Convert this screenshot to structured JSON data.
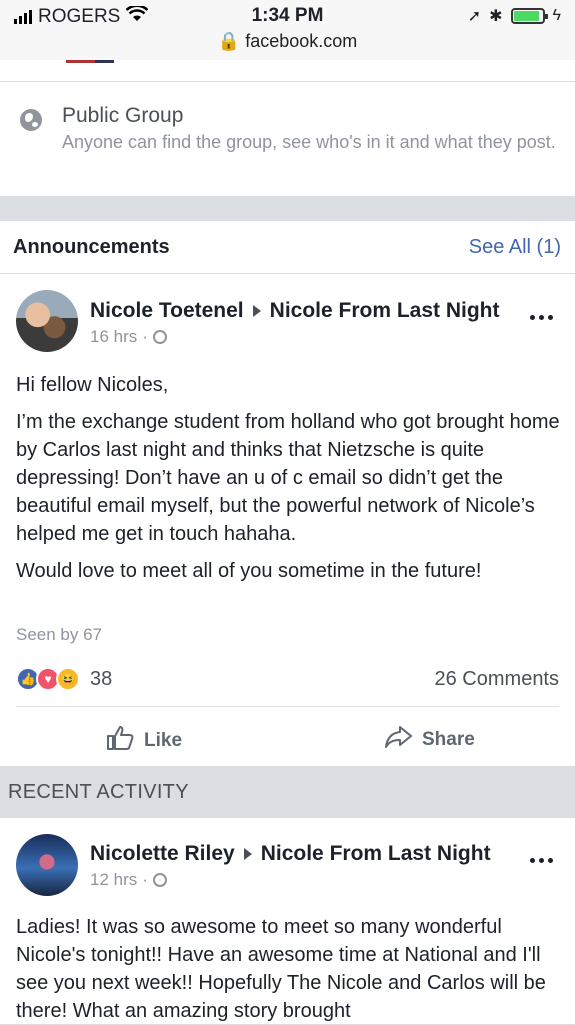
{
  "status": {
    "carrier": "ROGERS",
    "time": "1:34 PM",
    "url": "facebook.com"
  },
  "group_info": {
    "icon": "globe-icon",
    "title": "Public Group",
    "description": "Anyone can find the group, see who's in it and what they post."
  },
  "announcements": {
    "title": "Announcements",
    "see_all": "See All (1)",
    "post": {
      "author": "Nicole Toetenel",
      "group": "Nicole From Last Night",
      "time": "16 hrs",
      "paragraphs": [
        "Hi fellow Nicoles,",
        "I’m the exchange student from holland who got brought home by Carlos last night and thinks that Nietzsche is quite depressing! Don’t have an u of c email so didn’t get the beautiful email myself, but the powerful network of Nicole’s helped me get in touch hahaha.",
        "Would love to meet all of you sometime in the future!"
      ],
      "seen_by": "Seen by 67",
      "reaction_count": "38",
      "comments": "26 Comments",
      "like_label": "Like",
      "share_label": "Share"
    }
  },
  "recent": {
    "label": "RECENT ACTIVITY",
    "post": {
      "author": "Nicolette Riley",
      "group": "Nicole From Last Night",
      "time": "12 hrs",
      "text": "Ladies! It was so awesome to meet so many wonderful Nicole's tonight!! Have an awesome time at National and I'll see you next week!! Hopefully The Nicole and Carlos will be there! What an amazing story brought"
    }
  }
}
